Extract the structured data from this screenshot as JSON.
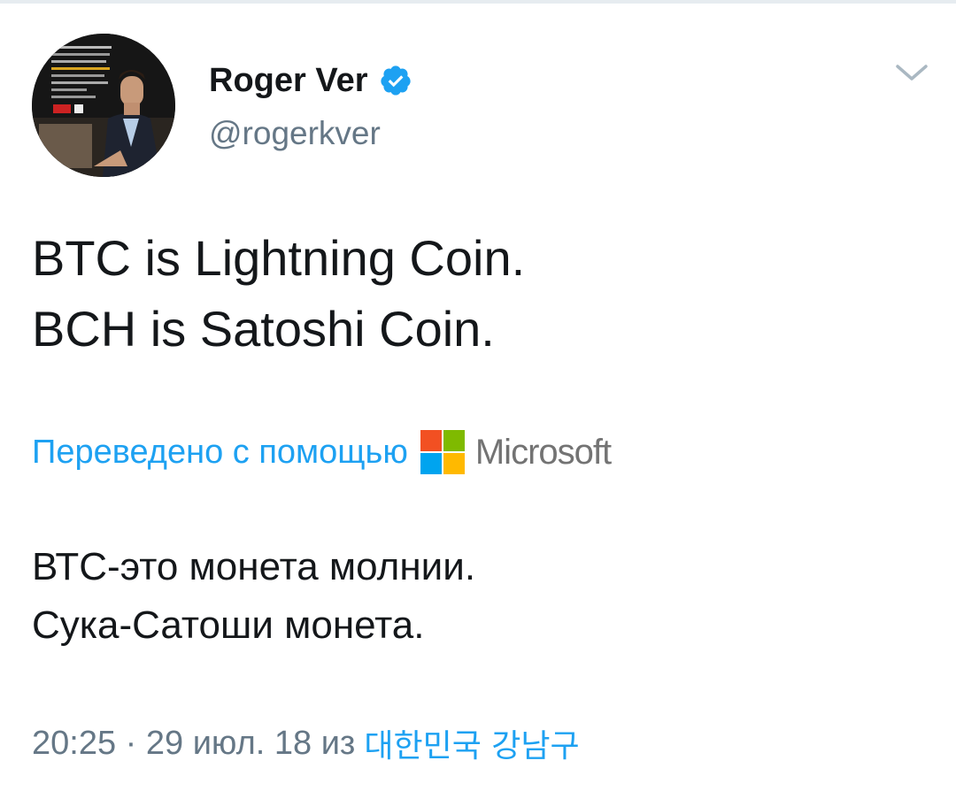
{
  "user": {
    "display_name": "Roger Ver",
    "handle": "@rogerkver",
    "avatar_icon": "profile-photo",
    "verified_icon": "verified-badge-icon",
    "verified_color": "#1da1f2"
  },
  "tweet": {
    "lines": [
      "BTC is Lightning Coin.",
      "BCH is Satoshi Coin."
    ]
  },
  "translation": {
    "label": "Переведено с помощью",
    "provider": "Microsoft",
    "lines": [
      "ВТС-это монета молнии.",
      "Сука-Сатоши монета."
    ]
  },
  "meta": {
    "time_date": "20:25 · 29 июл. 18 из",
    "location": "대한민국 강남구"
  },
  "colors": {
    "link": "#1da1f2",
    "secondary_text": "#657786",
    "primary_text": "#14171a"
  }
}
